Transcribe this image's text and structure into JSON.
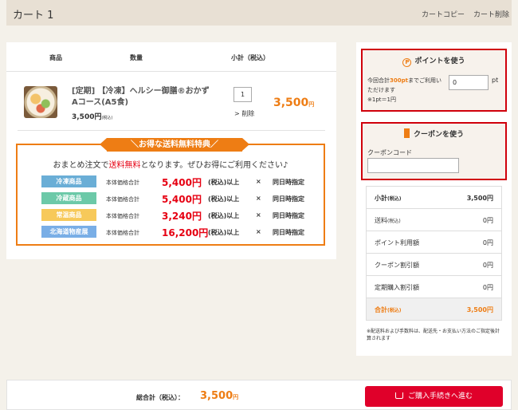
{
  "header": {
    "title": "カート 1",
    "copy_label": "カートコピー",
    "delete_label": "カート削除"
  },
  "table": {
    "col_product": "商品",
    "col_qty": "数量",
    "col_subtotal": "小計（税込）"
  },
  "item": {
    "name": "[定期] 【冷凍】ヘルシー御膳®おかず Aコース(A5食)",
    "price": "3,500円",
    "price_tax": "(税込)",
    "quantity": "1",
    "delete_label": "> 削除",
    "subtotal": "3,500",
    "subtotal_unit": "円"
  },
  "promo": {
    "ribbon": "＼お得な送料無料特典／",
    "message_pre": "おまとめ注文で",
    "message_red": "送料無料",
    "message_post": "となります。ぜひお得にご利用ください♪",
    "label": "本体価格合計",
    "condition": "(税込)以上",
    "cross": "×",
    "same_day": "同日時指定",
    "rows": [
      {
        "tag": "冷凍商品",
        "color": "#6aaed6",
        "amount": "5,400円"
      },
      {
        "tag": "冷蔵商品",
        "color": "#6cc9a8",
        "amount": "5,400円"
      },
      {
        "tag": "常温商品",
        "color": "#f7c95a",
        "amount": "3,240円"
      },
      {
        "tag": "北海道物産展",
        "color": "#79aee6",
        "amount": "16,200円"
      }
    ]
  },
  "points": {
    "icon": "P",
    "title": "ポイントを使う",
    "desc_pre": "今回合計",
    "desc_points": "300pt",
    "desc_post": "までご利用いただけます",
    "rate": "※1pt＝1円",
    "value": "0",
    "unit": "pt"
  },
  "coupon": {
    "title": "クーポンを使う",
    "code_label": "クーポンコード",
    "code_value": ""
  },
  "summary": {
    "rows": [
      {
        "label": "小計",
        "tax": "(税込)",
        "value": "3,500円"
      },
      {
        "label": "送料",
        "tax": "(税込)",
        "value": "0円"
      },
      {
        "label": "ポイント利用額",
        "tax": "",
        "value": "0円"
      },
      {
        "label": "クーポン割引額",
        "tax": "",
        "value": "0円"
      },
      {
        "label": "定期購入割引額",
        "tax": "",
        "value": "0円"
      },
      {
        "label": "合計",
        "tax": "(税込)",
        "value": "3,500円"
      }
    ],
    "note": "※配送料および手数料は、配送先・お支払い方法のご指定後計算されます"
  },
  "footer": {
    "total_label": "総合計（税込）：",
    "total_value": "3,500",
    "total_unit": "円",
    "checkout_label": "ご購入手続きへ進む"
  },
  "colors": {
    "accent": "#ee7d14",
    "red": "#e60012",
    "button": "#e0002a",
    "highlight_border": "#d0000b"
  }
}
